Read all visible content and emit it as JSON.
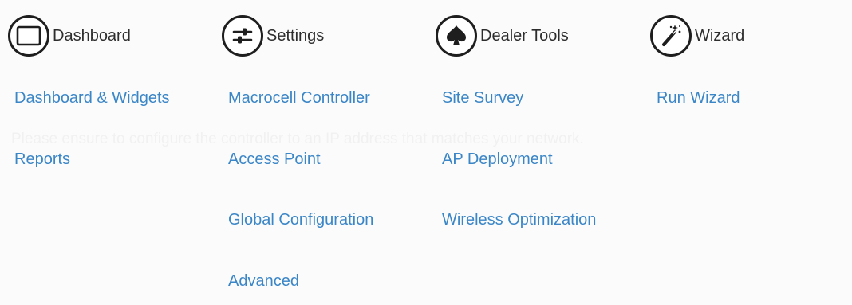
{
  "background_text": "Please ensure to configure the controller to an IP address that matches your network.",
  "colors": {
    "link": "#3b86c7",
    "header_text": "#2d2d2d",
    "icon_stroke": "#1e1e1e"
  },
  "menu": {
    "dashboard": {
      "label": "Dashboard",
      "icon": "dashboard-square-icon",
      "items": [
        "Dashboard & Widgets",
        "Reports"
      ]
    },
    "settings": {
      "label": "Settings",
      "icon": "sliders-icon",
      "items": [
        "Macrocell Controller",
        "Access Point",
        "Global Configuration",
        "Advanced"
      ]
    },
    "dealer_tools": {
      "label": "Dealer Tools",
      "icon": "spade-icon",
      "items": [
        "Site Survey",
        "AP Deployment",
        "Wireless Optimization"
      ]
    },
    "wizard": {
      "label": "Wizard",
      "icon": "magic-wand-icon",
      "items": [
        "Run Wizard"
      ]
    }
  }
}
